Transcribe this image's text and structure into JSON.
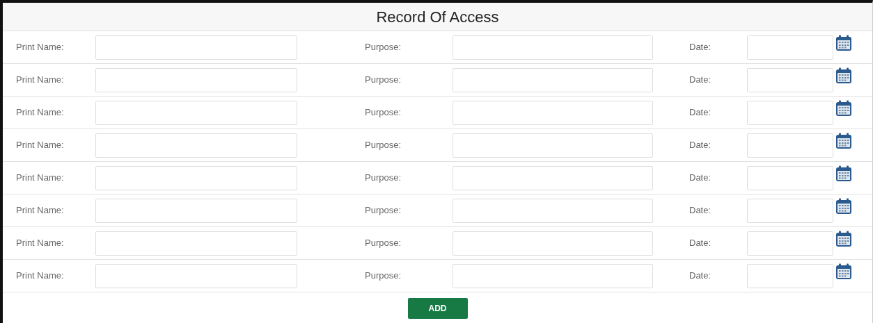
{
  "title": "Record Of Access",
  "rows": [
    {
      "name_label": "Print Name:",
      "purpose_label": "Purpose:",
      "date_label": "Date:"
    },
    {
      "name_label": "Print Name:",
      "purpose_label": "Purpose:",
      "date_label": "Date:"
    },
    {
      "name_label": "Print Name:",
      "purpose_label": "Purpose:",
      "date_label": "Date:"
    },
    {
      "name_label": "Print Name:",
      "purpose_label": "Purpose:",
      "date_label": "Date:"
    },
    {
      "name_label": "Print Name:",
      "purpose_label": "Purpose:",
      "date_label": "Date:"
    },
    {
      "name_label": "Print Name:",
      "purpose_label": "Purpose:",
      "date_label": "Date:"
    },
    {
      "name_label": "Print Name:",
      "purpose_label": "Purpose:",
      "date_label": "Date:"
    },
    {
      "name_label": "Print Name:",
      "purpose_label": "Purpose:",
      "date_label": "Date:"
    }
  ],
  "add_button": "ADD"
}
